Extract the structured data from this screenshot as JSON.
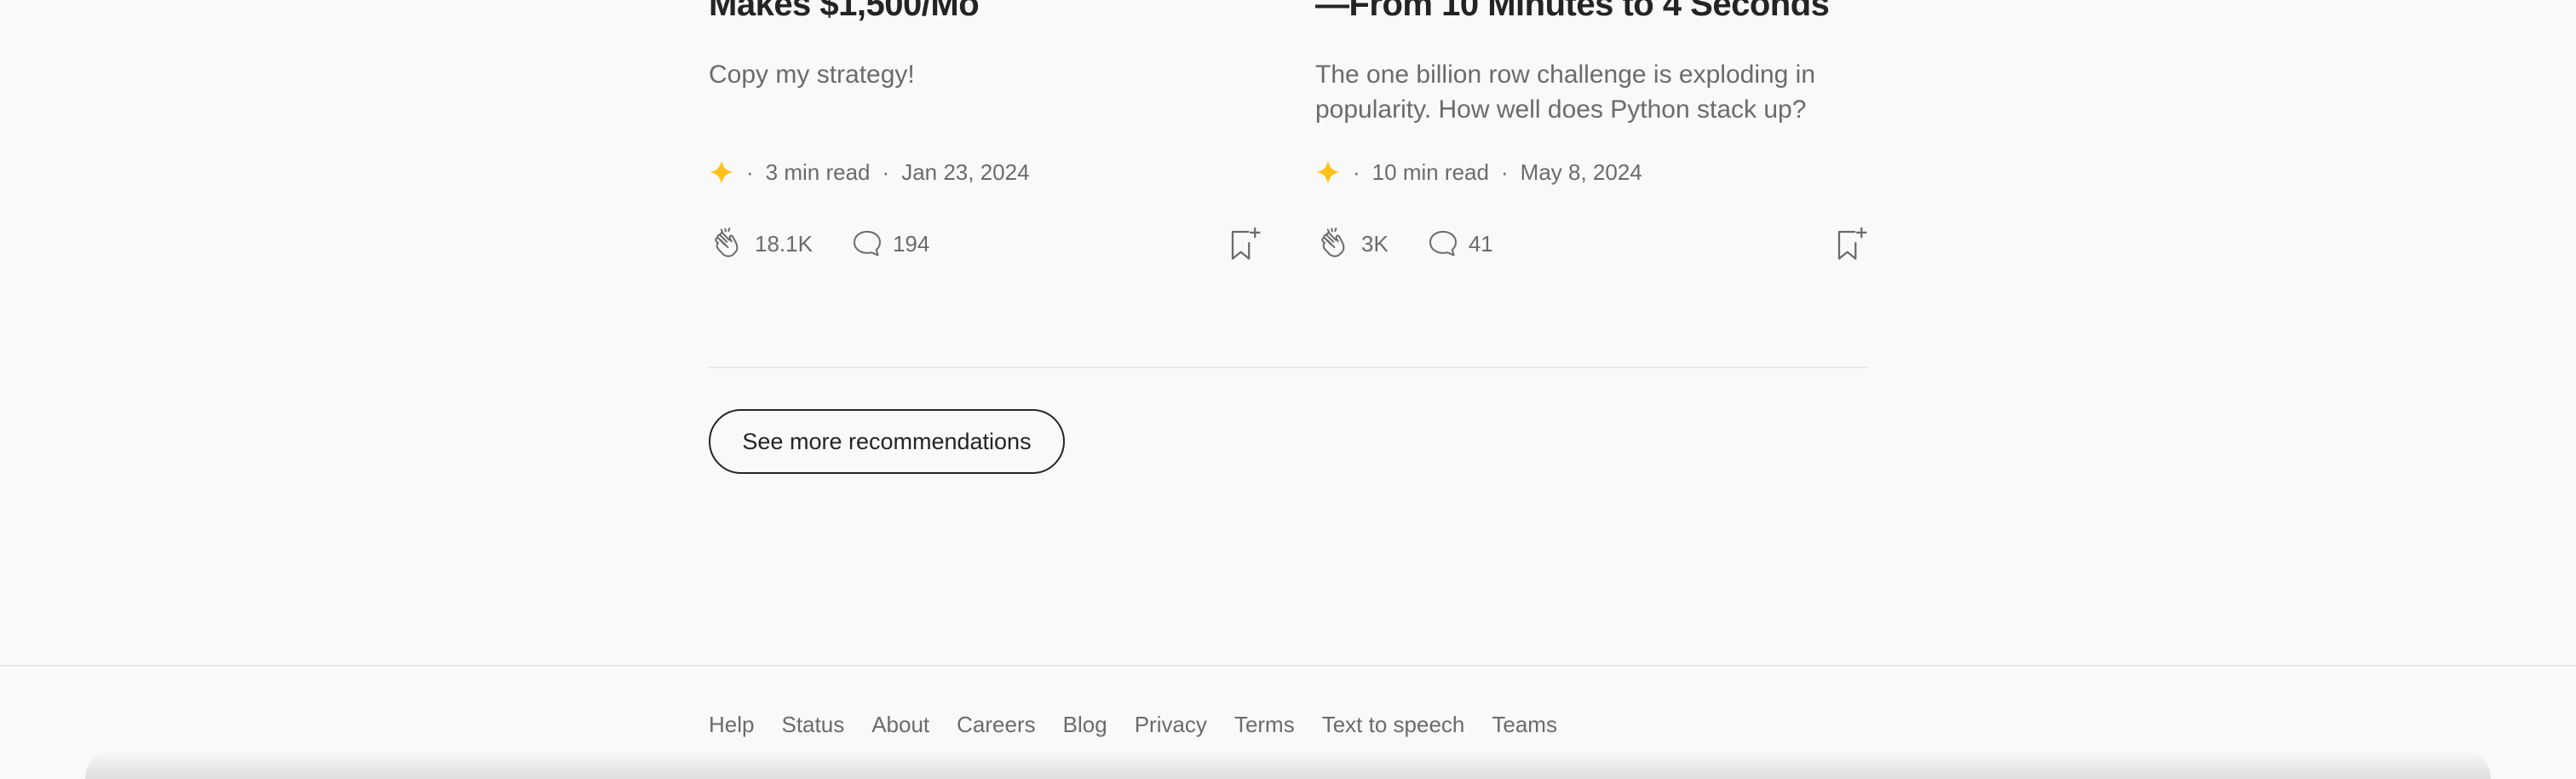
{
  "articles": [
    {
      "title_line": "Makes $1,500/Mo",
      "subtitle": "Copy my strategy!",
      "meta": {
        "read_time": "3 min read",
        "date": "Jan 23, 2024"
      },
      "claps": "18.1K",
      "responses": "194"
    },
    {
      "title_line": "—From 10 Minutes to 4 Seconds",
      "subtitle": "The one billion row challenge is exploding in popularity. How well does Python stack up?",
      "meta": {
        "read_time": "10 min read",
        "date": "May 8, 2024"
      },
      "claps": "3K",
      "responses": "41"
    }
  ],
  "meta_separator": "·",
  "see_more_label": "See more recommendations",
  "footer": {
    "links": [
      "Help",
      "Status",
      "About",
      "Careers",
      "Blog",
      "Privacy",
      "Terms",
      "Text to speech",
      "Teams"
    ]
  },
  "icons": {
    "member_star": "star-icon",
    "clap": "clap-icon",
    "response": "comment-icon",
    "save": "bookmark-add-icon"
  },
  "colors": {
    "star": "#FFC017",
    "text": "#242424",
    "muted": "#6b6b6b"
  }
}
